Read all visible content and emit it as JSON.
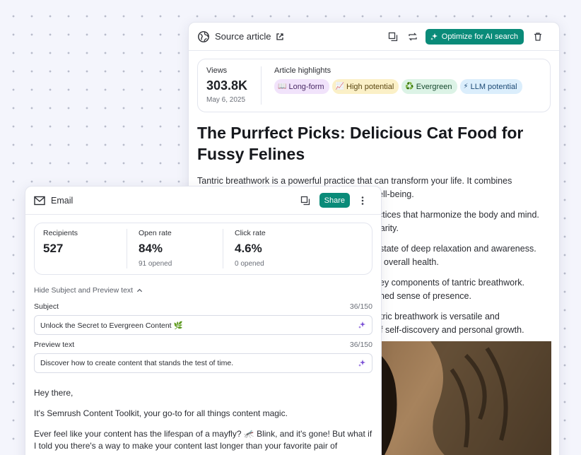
{
  "article": {
    "title": "Source article",
    "optimize_label": "Optimize for AI search",
    "views_label": "Views",
    "views_value": "303.8K",
    "views_date": "May 6, 2025",
    "highlights_label": "Article highlights",
    "tags": [
      {
        "emoji": "📖",
        "label": "Long-form"
      },
      {
        "emoji": "📈",
        "label": "High potential"
      },
      {
        "emoji": "♻️",
        "label": "Evergreen"
      },
      {
        "emoji": "⚡",
        "label": "LLM potential"
      }
    ],
    "headline": "The Purrfect Picks: Delicious Cat Food for Fussy Felines",
    "paragraphs": [
      "Tantric breathwork is a powerful practice that can transform your life. It combines",
      "ell-being.",
      "ctices that harmonize the body and mind.",
      "larity.",
      "state of deep relaxation and awareness.",
      "overall health.",
      "ey components of tantric breathwork.",
      "ned sense of presence.",
      "tric breathwork is versatile and",
      "f self-discovery and personal growth."
    ]
  },
  "email": {
    "title": "Email",
    "share_label": "Share",
    "stats": [
      {
        "label": "Recipients",
        "value": "527",
        "sub": ""
      },
      {
        "label": "Open rate",
        "value": "84%",
        "sub": "91 opened"
      },
      {
        "label": "Click rate",
        "value": "4.6%",
        "sub": "0 opened"
      }
    ],
    "toggle_label": "Hide Subject and Preview text",
    "subject_label": "Subject",
    "subject_count": "36/150",
    "subject_value": "Unlock the Secret to Evergreen Content 🌿",
    "preview_label": "Preview text",
    "preview_count": "36/150",
    "preview_value": "Discover how to create content that stands the test of time.",
    "body": [
      "Hey there,",
      "It's Semrush Content Toolkit, your go-to for all things content magic.",
      "Ever feel like your content has the lifespan of a mayfly? 🦟 Blink, and it's gone! But what if I told you there's a way to make your content last longer than your favorite pair of"
    ]
  },
  "colors": {
    "accent": "#0a8b79"
  },
  "icons": [
    "globe-icon",
    "external-link-icon",
    "copy-icon",
    "refresh-icon",
    "sparkle-icon",
    "trash-icon",
    "mail-icon",
    "more-vertical-icon",
    "chevron-up-icon"
  ]
}
